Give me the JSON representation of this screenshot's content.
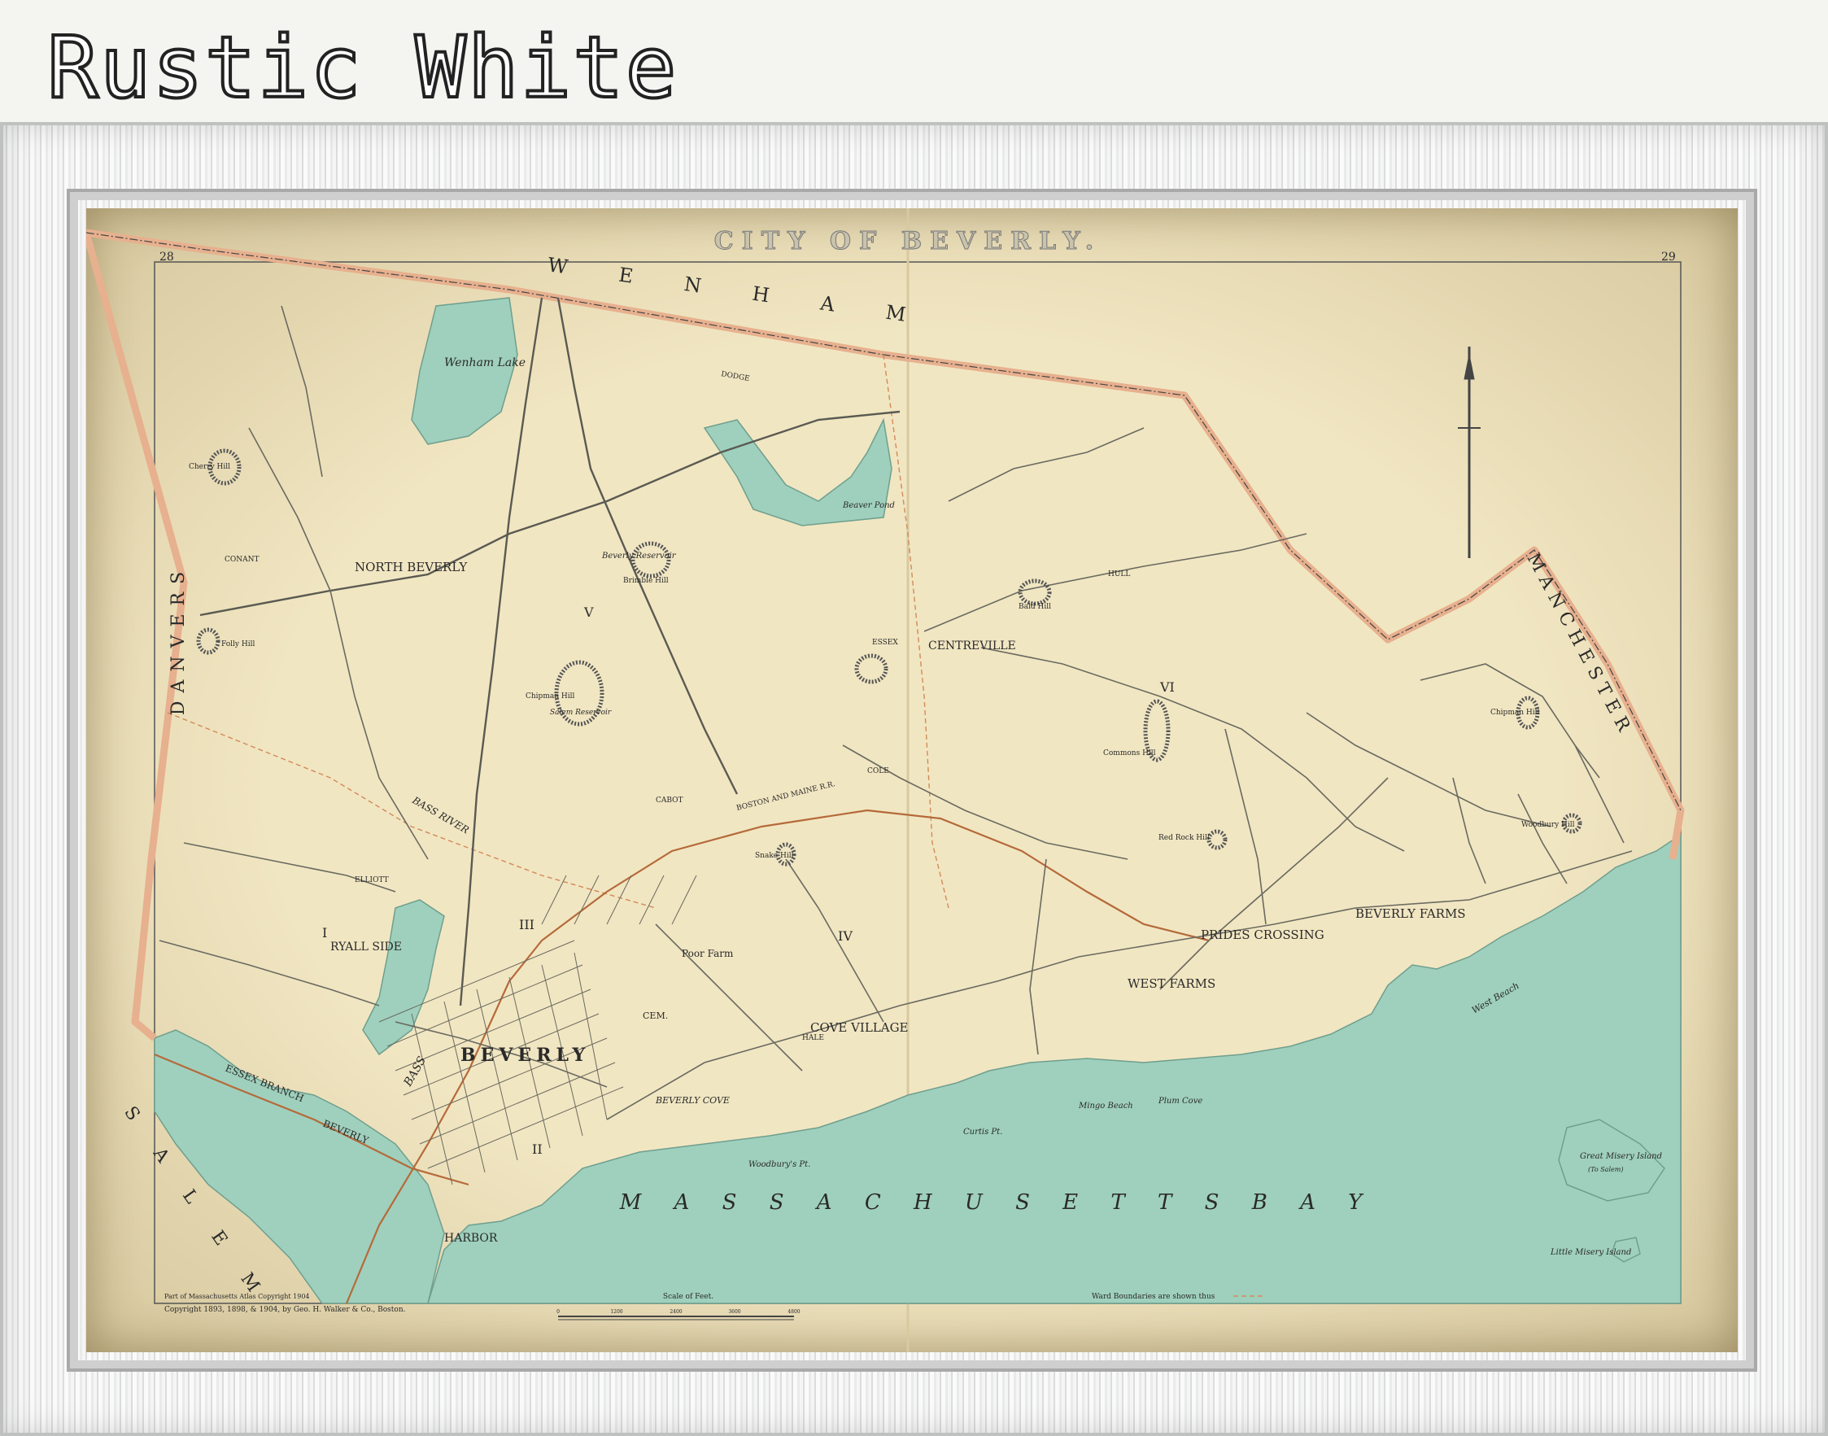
{
  "frame_label": "Rustic White",
  "map": {
    "title": "CITY OF BEVERLY.",
    "page_left": "28",
    "page_right": "29",
    "towns": {
      "wenham": "W E N H A M",
      "danvers": "DANVERS",
      "manchester": "MANCHESTER",
      "salem": "S A L E M"
    },
    "places": {
      "north_beverly": "NORTH BEVERLY",
      "centreville": "CENTREVILLE",
      "ryall_side": "RYALL SIDE",
      "prides_crossing": "PRIDES CROSSING",
      "beverly_farms": "BEVERLY FARMS",
      "west_farms": "WEST FARMS",
      "cove_village": "COVE VILLAGE",
      "beverly": "BEVERLY",
      "poor_farm": "Poor Farm",
      "cem": "CEM."
    },
    "wards": [
      "I",
      "II",
      "III",
      "IV",
      "V",
      "VI"
    ],
    "hills": {
      "cherry": "Cherry Hill",
      "folly": "Folly Hill",
      "chipman_left": "Chipman Hill",
      "brimble": "Brimble Hill",
      "snake": "Snake Hill",
      "bald": "Bald Hill",
      "commons": "Commons Hill",
      "red_rock": "Red Rock Hill",
      "chipman_right": "Chipman Hill",
      "woodbury": "Woodbury Hill"
    },
    "water": {
      "wenham_lake": "Wenham Lake",
      "beverly_reservoir": "Beverly Reservoir",
      "salem_reservoir": "Salem Reservoir",
      "beaver_pond": "Beaver Pond",
      "bass_river": "BASS RIVER",
      "bass": "BASS",
      "beverly_cove": "BEVERLY COVE",
      "beverly_harbor": "HARBOR",
      "massachusetts_bay": "M A S S A C H U S E T T S     B A Y",
      "west_beach": "West Beach",
      "mingo_beach": "Mingo Beach",
      "plum_cove": "Plum Cove",
      "curtis_pt": "Curtis Pt.",
      "woodburys_pt": "Woodbury's Pt.",
      "great_misery": "Great Misery Island",
      "great_misery_note": "(To Salem)",
      "little_misery": "Little Misery Island"
    },
    "roads": {
      "dodge": "DODGE",
      "hull": "HULL",
      "conant": "CONANT",
      "elliott": "ELLIOTT",
      "essex": "ESSEX",
      "cole": "COLE",
      "hale": "HALE",
      "cabot": "CABOT",
      "boston_maine": "BOSTON AND MAINE R.R.",
      "essex_branch": "ESSEX BRANCH",
      "beverly_branch": "BEVERLY"
    },
    "footer": {
      "atlas_note": "Part of Massachusetts Atlas Copyright 1904",
      "copyright": "Copyright 1893, 1898, & 1904, by Geo. H. Walker & Co., Boston.",
      "scale_title": "Scale of Feet.",
      "scale_ticks": [
        "0",
        "1200",
        "2400",
        "3600",
        "4800"
      ],
      "ward_note": "Ward Boundaries are shown thus"
    },
    "colors": {
      "paper": "#f1e6c2",
      "water": "#9fd0bd",
      "boundary": "#e7b08e",
      "rail": "#b56a3a"
    }
  }
}
